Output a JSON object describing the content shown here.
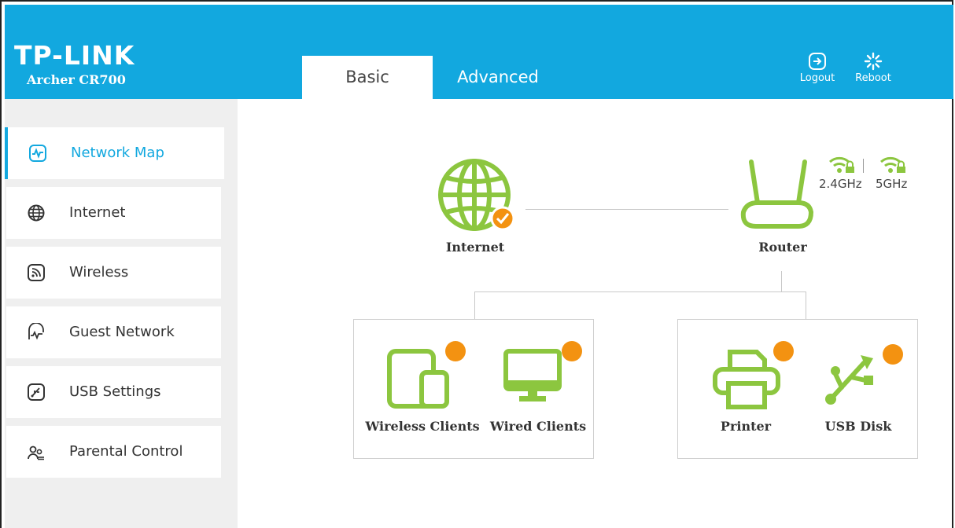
{
  "brand": {
    "logo": "TP-LINK",
    "model": "Archer CR700"
  },
  "tabs": [
    {
      "label": "Basic"
    },
    {
      "label": "Advanced"
    }
  ],
  "header_buttons": {
    "logout": "Logout",
    "reboot": "Reboot"
  },
  "sidebar": {
    "items": [
      {
        "label": "Network Map",
        "icon": "network-map-icon",
        "active": true
      },
      {
        "label": "Internet",
        "icon": "globe-icon"
      },
      {
        "label": "Wireless",
        "icon": "wireless-icon"
      },
      {
        "label": "Guest Network",
        "icon": "guest-network-icon"
      },
      {
        "label": "USB Settings",
        "icon": "usb-icon"
      },
      {
        "label": "Parental Control",
        "icon": "parental-control-icon"
      }
    ]
  },
  "map": {
    "internet": "Internet",
    "router": "Router",
    "band_24": "2.4GHz",
    "band_5": "5GHz",
    "wireless_clients": "Wireless Clients",
    "wired_clients": "Wired Clients",
    "printer": "Printer",
    "usb_disk": "USB Disk"
  },
  "colors": {
    "header": "#12a8df",
    "accent_green": "#8cc63f",
    "badge_orange": "#f39211"
  }
}
